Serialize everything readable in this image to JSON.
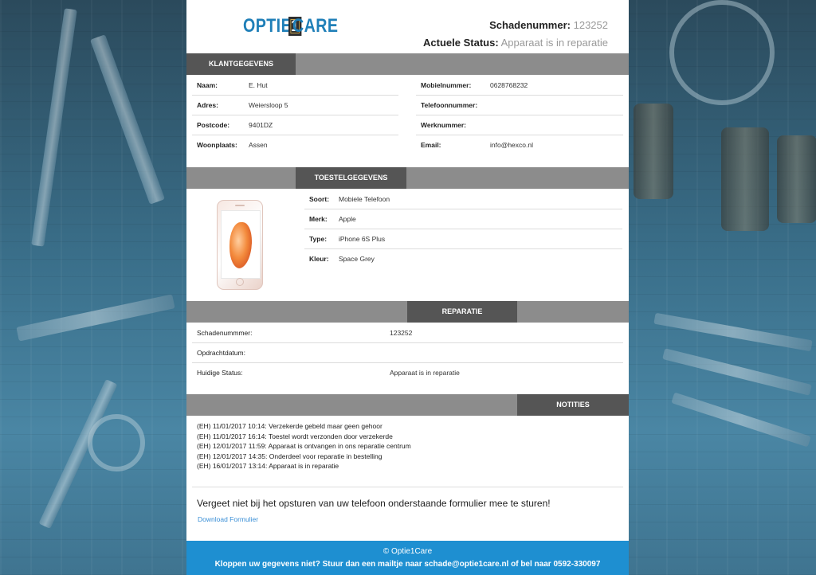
{
  "header": {
    "logo": {
      "left": "OPTIE",
      "box": "1",
      "right": "CARE"
    },
    "damage_label": "Schadenummer:",
    "damage_value": "123252",
    "status_label": "Actuele Status:",
    "status_value": "Apparaat is in reparatie"
  },
  "klant": {
    "title": "KLANTGEGEVENS",
    "left": [
      {
        "label": "Naam:",
        "value": "E. Hut"
      },
      {
        "label": "Adres:",
        "value": "Weiersloop 5"
      },
      {
        "label": "Postcode:",
        "value": "9401DZ"
      },
      {
        "label": "Woonplaats:",
        "value": "Assen"
      }
    ],
    "right": [
      {
        "label": "Mobielnummer:",
        "value": "0628768232"
      },
      {
        "label": "Telefoonnummer:",
        "value": ""
      },
      {
        "label": "Werknummer:",
        "value": ""
      },
      {
        "label": "Email:",
        "value": "info@hexco.nl"
      }
    ]
  },
  "toestel": {
    "title": "TOESTELGEGEVENS",
    "rows": [
      {
        "label": "Soort:",
        "value": "Mobiele Telefoon"
      },
      {
        "label": "Merk:",
        "value": "Apple"
      },
      {
        "label": "Type:",
        "value": "iPhone 6S Plus"
      },
      {
        "label": "Kleur:",
        "value": "Space Grey"
      }
    ]
  },
  "reparatie": {
    "title": "REPARATIE",
    "rows": [
      {
        "label": "Schadenummmer:",
        "value": "123252"
      },
      {
        "label": "Opdrachtdatum:",
        "value": ""
      },
      {
        "label": "Huidige Status:",
        "value": "Apparaat is in reparatie"
      }
    ]
  },
  "notities": {
    "title": "NOTITIES",
    "items": [
      "(EH) 11/01/2017 10:14: Verzekerde gebeld maar geen gehoor",
      "(EH) 11/01/2017 16:14: Toestel wordt verzonden door verzekerde",
      "(EH) 12/01/2017 11:59: Apparaat is ontvangen in ons reparatie centrum",
      "(EH) 12/01/2017 14:35: Onderdeel voor reparatie in bestelling",
      "(EH) 16/01/2017 13:14: Apparaat is in reparatie"
    ]
  },
  "reminder": "Vergeet niet bij het opsturen van uw telefoon onderstaande formulier mee te sturen!",
  "download_link": "Download Formulier",
  "footer": {
    "copyright": "© Optie1Care",
    "msg_prefix": "Kloppen uw gegevens niet? Stuur dan een mailtje naar",
    "email": "schade@optie1care.nl",
    "msg_middle": "of bel naar",
    "phone": "0592-330097"
  },
  "colors": {
    "brand_blue": "#1f7fb8",
    "footer_blue": "#1e8fd1",
    "tab_dark": "#555555",
    "bar_grey": "#8c8c8c",
    "link_blue": "#3a8fd6"
  }
}
